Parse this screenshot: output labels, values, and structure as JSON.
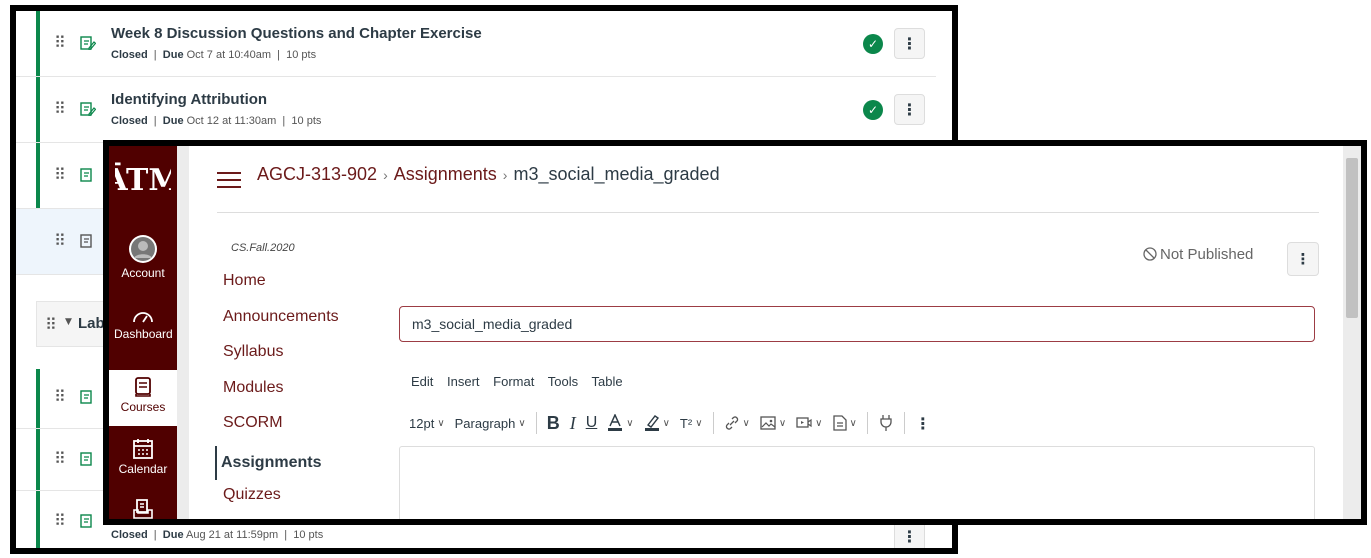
{
  "back_window": {
    "rows": [
      {
        "title": "Week 8 Discussion Questions and Chapter Exercise",
        "status": "Closed",
        "due_label": "Due",
        "due": "Oct 7 at 10:40am",
        "points": "10 pts"
      },
      {
        "title": "Identifying Attribution",
        "status": "Closed",
        "due_label": "Due",
        "due": "Oct 12 at 11:30am",
        "points": "10 pts"
      }
    ],
    "group_label": "Lab",
    "partial_row": {
      "status": "Closed",
      "due_label": "Due",
      "due": "Aug 21 at 11:59pm",
      "points": "10 pts"
    }
  },
  "global_nav": {
    "items": [
      {
        "label": "Account",
        "icon": "account-avatar-icon"
      },
      {
        "label": "Dashboard",
        "icon": "dashboard-icon"
      },
      {
        "label": "Courses",
        "icon": "courses-icon"
      },
      {
        "label": "Calendar",
        "icon": "calendar-icon"
      },
      {
        "label": "Inbox",
        "icon": "inbox-icon"
      }
    ],
    "logo": "texas-am-logo"
  },
  "breadcrumb": {
    "course": "AGCJ-313-902",
    "section": "Assignments",
    "current": "m3_social_media_graded",
    "separator": "›"
  },
  "term": "CS.Fall.2020",
  "course_nav": [
    "Home",
    "Announcements",
    "Syllabus",
    "Modules",
    "SCORM",
    "Assignments",
    "Quizzes"
  ],
  "course_nav_active": "Assignments",
  "publish_status": "Not Published",
  "assignment_name": "m3_social_media_graded",
  "editor_menu": [
    "Edit",
    "Insert",
    "Format",
    "Tools",
    "Table"
  ],
  "toolbar": {
    "font_size": "12pt",
    "block_format": "Paragraph",
    "bold": "B",
    "italic": "I",
    "underline": "U",
    "superscript": "T²",
    "more": "⋮"
  },
  "colors": {
    "nav_bg": "#500000",
    "link": "#6b1a1a",
    "success": "#0b874b",
    "text": "#2d3b45"
  }
}
